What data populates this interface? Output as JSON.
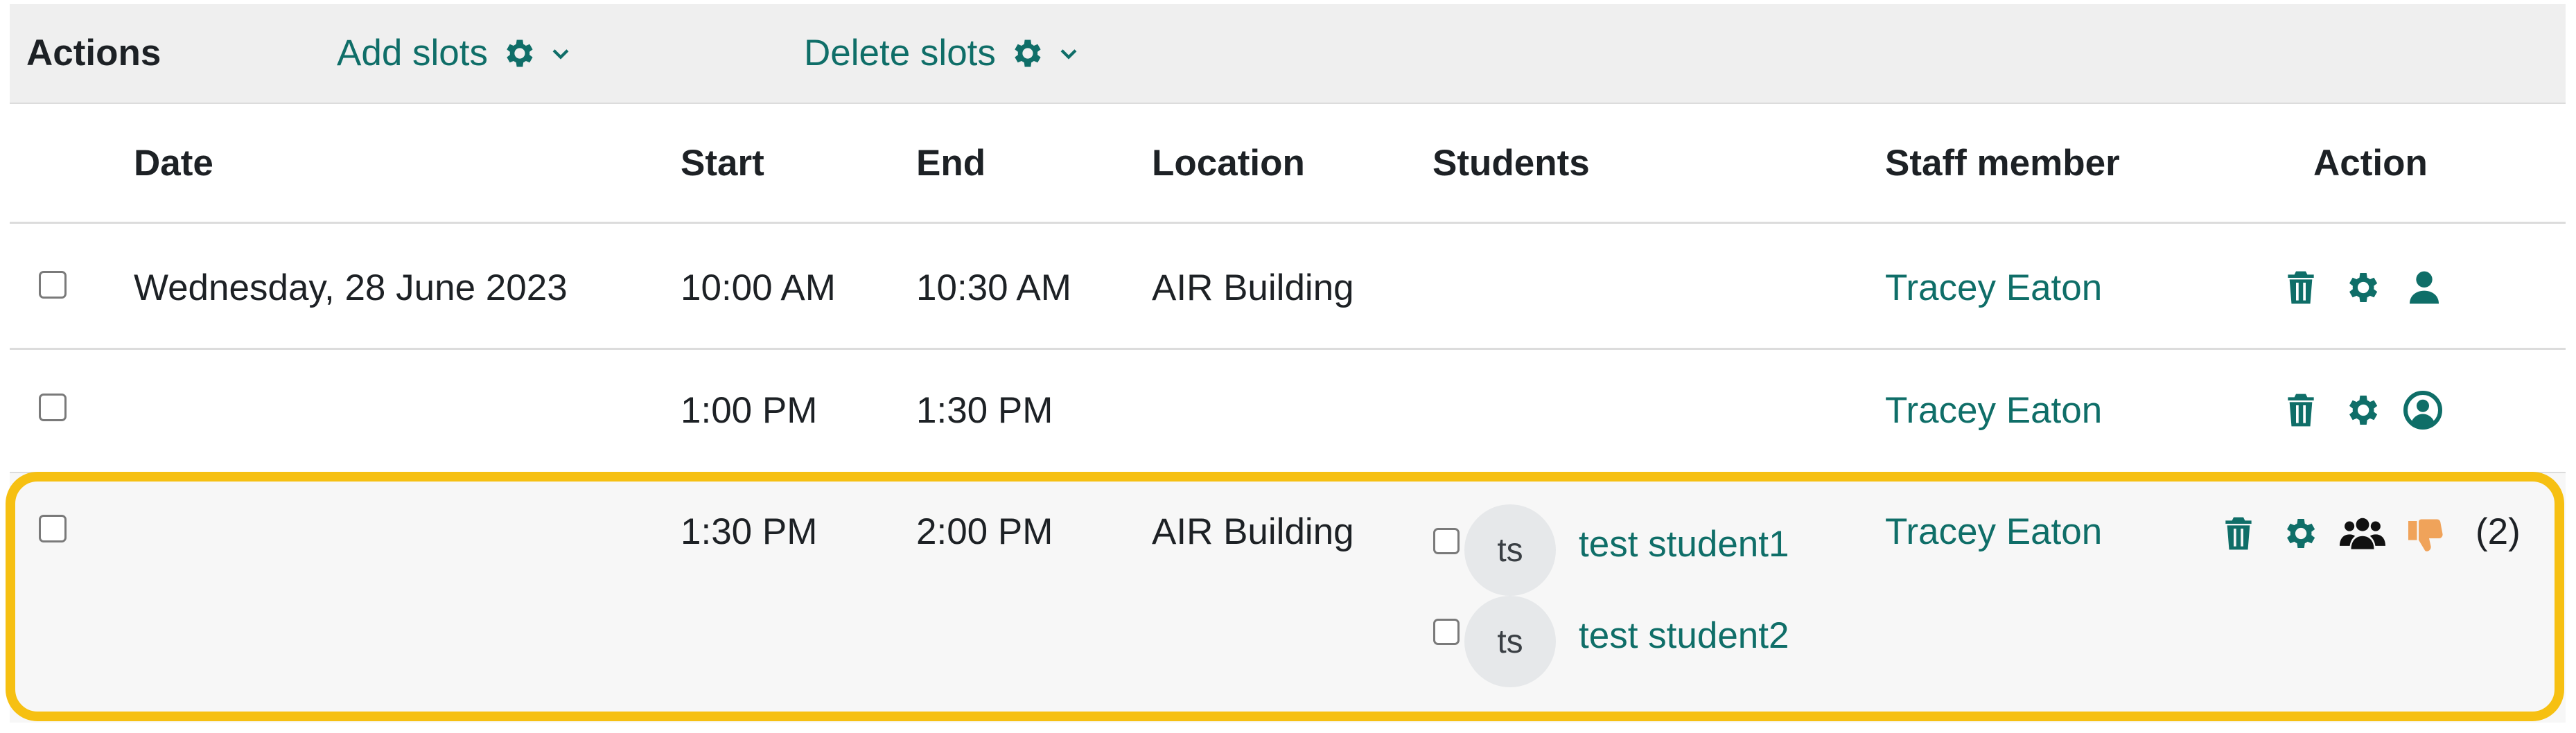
{
  "actions_bar": {
    "label": "Actions",
    "add_slots": "Add slots",
    "delete_slots": "Delete slots"
  },
  "table": {
    "headers": {
      "date": "Date",
      "start": "Start",
      "end": "End",
      "location": "Location",
      "students": "Students",
      "staff": "Staff member",
      "action": "Action"
    },
    "rows": [
      {
        "date": "Wednesday, 28 June 2023",
        "start": "10:00 AM",
        "end": "10:30 AM",
        "location": "AIR Building",
        "staff": "Tracey Eaton"
      },
      {
        "date": "",
        "start": "1:00 PM",
        "end": "1:30 PM",
        "location": "",
        "staff": "Tracey Eaton"
      },
      {
        "date": "",
        "start": "1:30 PM",
        "end": "2:00 PM",
        "location": "AIR Building",
        "staff": "Tracey Eaton",
        "students": [
          {
            "initials": "ts",
            "name": "test student1"
          },
          {
            "initials": "ts",
            "name": "test student2"
          }
        ],
        "count": "(2)"
      }
    ]
  },
  "colors": {
    "accent": "#0f6e68",
    "highlight": "#f6c012",
    "thumb": "#f0a35a"
  },
  "icons": [
    "gear-icon",
    "chevron-down-icon",
    "trash-icon",
    "user-icon",
    "user-circle-icon",
    "users-icon",
    "thumbs-down-icon"
  ]
}
